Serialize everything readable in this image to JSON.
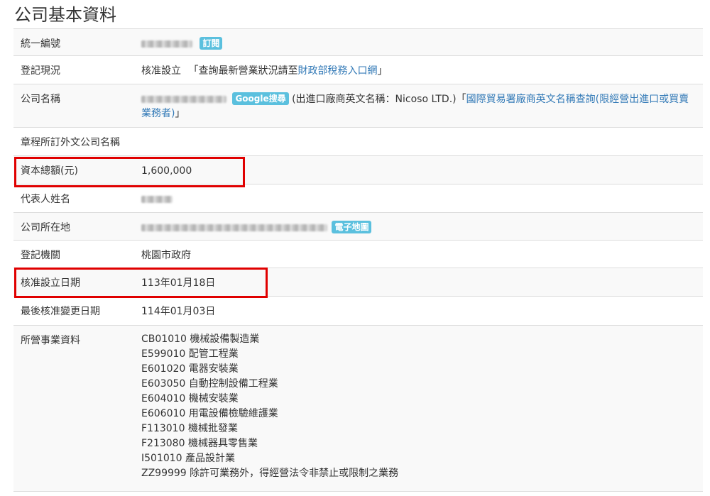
{
  "page": {
    "title": "公司基本資料"
  },
  "rows": {
    "tax_id": {
      "label": "統一編號",
      "subscribe_label": "訂閱"
    },
    "status": {
      "label": "登記現況",
      "value": "核准設立",
      "note_prefix": "「查詢最新營業狀況請至",
      "note_link": "財政部稅務入口網",
      "note_suffix": "」"
    },
    "company_name": {
      "label": "公司名稱",
      "google_label": "Google搜尋",
      "english_name_note": "(出進口廠商英文名稱：Nicoso LTD.)",
      "intl_prefix": "「",
      "intl_link": "國際貿易署廠商英文名稱查詢(限經營出進口或買賣業務者)",
      "intl_suffix": "」"
    },
    "foreign_name": {
      "label": "章程所訂外文公司名稱"
    },
    "capital": {
      "label": "資本總額(元)",
      "value": "1,600,000"
    },
    "representative": {
      "label": "代表人姓名"
    },
    "address": {
      "label": "公司所在地",
      "map_label": "電子地圖"
    },
    "authority": {
      "label": "登記機關",
      "value": "桃園市政府"
    },
    "approval_date": {
      "label": "核准設立日期",
      "value": "113年01月18日"
    },
    "last_change_date": {
      "label": "最後核准變更日期",
      "value": "114年01月03日"
    },
    "business_items": {
      "label": "所營事業資料",
      "items": [
        "CB01010 機械設備製造業",
        "E599010 配管工程業",
        "E601020 電器安裝業",
        "E603050 自動控制設備工程業",
        "E604010 機械安裝業",
        "E606010 用電設備檢驗維護業",
        "F113010 機械批發業",
        "F213080 機械器具零售業",
        "I501010 產品設計業",
        "ZZ99999 除許可業務外，得經營法令非禁止或限制之業務"
      ]
    }
  },
  "colors": {
    "highlight": "#e00000",
    "badge": "#5bc0de",
    "link": "#337ab7"
  }
}
